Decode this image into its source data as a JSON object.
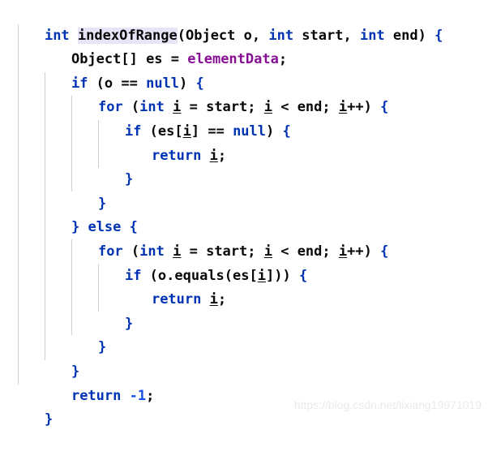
{
  "editor": {
    "language": "java",
    "theme": "IntelliJ Light",
    "colors": {
      "background": "#ffffff",
      "keyword": "#0033b3",
      "identifier": "#080808",
      "field": "#871094",
      "number": "#1750eb",
      "indent_guide": "#cdd0d9",
      "identifier_highlight_bg": "#e8e4f7",
      "watermark": "#eaeaea"
    },
    "highlighted_identifier": "indexOfRange",
    "lines": [
      {
        "n": 1,
        "indent": 0,
        "text": "int indexOfRange(Object o, int start, int end) {"
      },
      {
        "n": 2,
        "indent": 1,
        "text": "Object[] es = elementData;"
      },
      {
        "n": 3,
        "indent": 1,
        "text": "if (o == null) {"
      },
      {
        "n": 4,
        "indent": 2,
        "text": "for (int i = start; i < end; i++) {"
      },
      {
        "n": 5,
        "indent": 3,
        "text": "if (es[i] == null) {"
      },
      {
        "n": 6,
        "indent": 4,
        "text": "return i;"
      },
      {
        "n": 7,
        "indent": 3,
        "text": "}"
      },
      {
        "n": 8,
        "indent": 2,
        "text": "}"
      },
      {
        "n": 9,
        "indent": 1,
        "text": "} else {"
      },
      {
        "n": 10,
        "indent": 2,
        "text": "for (int i = start; i < end; i++) {"
      },
      {
        "n": 11,
        "indent": 3,
        "text": "if (o.equals(es[i])) {"
      },
      {
        "n": 12,
        "indent": 4,
        "text": "return i;"
      },
      {
        "n": 13,
        "indent": 3,
        "text": "}"
      },
      {
        "n": 14,
        "indent": 2,
        "text": "}"
      },
      {
        "n": 15,
        "indent": 1,
        "text": "}"
      },
      {
        "n": 16,
        "indent": 1,
        "text": "return -1;"
      },
      {
        "n": 17,
        "indent": 0,
        "text": "}"
      }
    ],
    "tokens": {
      "l1": {
        "t1": "int",
        "t2": "indexOfRange",
        "t3": "(Object o, ",
        "t4": "int",
        "t5": " start, ",
        "t6": "int",
        "t7": " end) ",
        "t8": "{"
      },
      "l2": {
        "t1": "Object[] es = ",
        "t2": "elementData",
        "t3": ";"
      },
      "l3": {
        "t1": "if",
        "t2": " (o == ",
        "t3": "null",
        "t4": ") ",
        "t5": "{"
      },
      "l4": {
        "t1": "for",
        "t2": " (",
        "t3": "int",
        "t4": " ",
        "t5": "i",
        "t6": " = start; ",
        "t7": "i",
        "t8": " < end; ",
        "t9": "i",
        "t10": "++) ",
        "t11": "{"
      },
      "l5": {
        "t1": "if",
        "t2": " (es[",
        "t3": "i",
        "t4": "] == ",
        "t5": "null",
        "t6": ") ",
        "t7": "{"
      },
      "l6": {
        "t1": "return",
        "t2": " ",
        "t3": "i",
        "t4": ";"
      },
      "l7": {
        "t1": "}"
      },
      "l8": {
        "t1": "}"
      },
      "l9": {
        "t1": "}",
        "t2": " ",
        "t3": "else",
        "t4": " ",
        "t5": "{"
      },
      "l10": {
        "t1": "for",
        "t2": " (",
        "t3": "int",
        "t4": " ",
        "t5": "i",
        "t6": " = start; ",
        "t7": "i",
        "t8": " < end; ",
        "t9": "i",
        "t10": "++) ",
        "t11": "{"
      },
      "l11": {
        "t1": "if",
        "t2": " (o.equals(es[",
        "t3": "i",
        "t4": "])) ",
        "t5": "{"
      },
      "l12": {
        "t1": "return",
        "t2": " ",
        "t3": "i",
        "t4": ";"
      },
      "l13": {
        "t1": "}"
      },
      "l14": {
        "t1": "}"
      },
      "l15": {
        "t1": "}"
      },
      "l16": {
        "t1": "return",
        "t2": " ",
        "t3": "-1",
        "t4": ";"
      },
      "l17": {
        "t1": "}"
      }
    }
  },
  "watermark": {
    "text": "https://blog.csdn.net/lixiang19971019"
  }
}
